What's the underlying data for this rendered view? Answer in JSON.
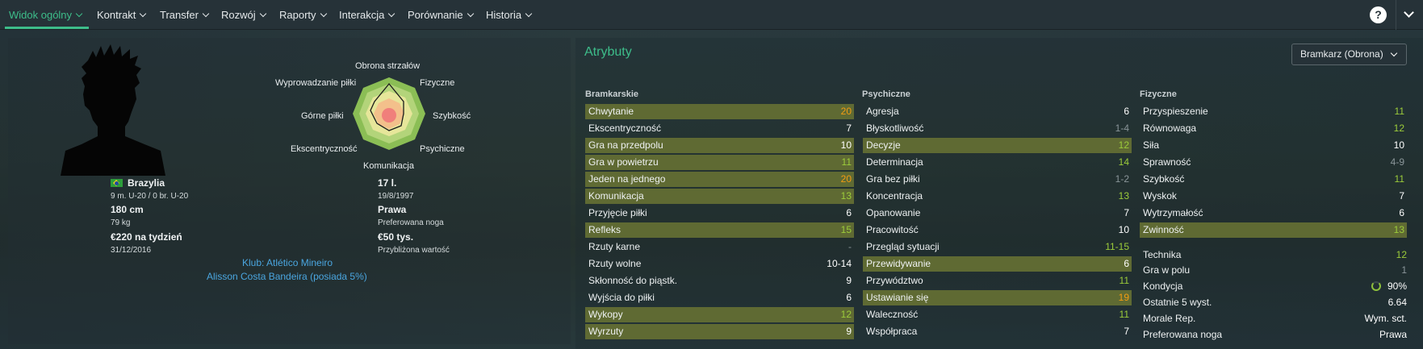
{
  "tabs": [
    {
      "label": "Widok ogólny",
      "active": true
    },
    {
      "label": "Kontrakt"
    },
    {
      "label": "Transfer"
    },
    {
      "label": "Rozwój"
    },
    {
      "label": "Raporty"
    },
    {
      "label": "Interakcja"
    },
    {
      "label": "Porównanie"
    },
    {
      "label": "Historia"
    }
  ],
  "help_label": "?",
  "radar": {
    "labels": {
      "top": "Obrona strzałów",
      "top_left": "Wyprowadzanie piłki",
      "top_right": "Fizyczne",
      "left": "Górne piłki",
      "right": "Szybkość",
      "bottom_left": "Ekscentryczność",
      "bottom_right": "Psychiczne",
      "bottom": "Komunikacja"
    }
  },
  "bio": {
    "nationality": "Brazylia",
    "caps": "9 m. U-20 / 0 br. U-20",
    "height": "180 cm",
    "weight": "79 kg",
    "wage": "€220 na tydzień",
    "contract_end": "31/12/2016",
    "age": "17 l.",
    "dob": "19/8/1997",
    "foot": "Prawa",
    "foot_label": "Preferowana noga",
    "value": "€50 tys.",
    "value_label": "Przybliżona wartość",
    "club": "Klub: Atlético Mineiro",
    "owner": "Alisson Costa Bandeira (posiada 5%)"
  },
  "attributes_title": "Atrybuty",
  "role_select": "Bramkarz (Obrona)",
  "columns": [
    {
      "header": "Bramkarskie",
      "rows": [
        {
          "name": "Chwytanie",
          "value": "20",
          "color": "#f39c12",
          "hl": true
        },
        {
          "name": "Ekscentryczność",
          "value": "7",
          "color": "#ffffff",
          "hl": false
        },
        {
          "name": "Gra na przedpolu",
          "value": "10",
          "color": "#ffffff",
          "hl": true
        },
        {
          "name": "Gra w powietrzu",
          "value": "11",
          "color": "#9ccc3a",
          "hl": true
        },
        {
          "name": "Jeden na jednego",
          "value": "20",
          "color": "#f39c12",
          "hl": true
        },
        {
          "name": "Komunikacja",
          "value": "13",
          "color": "#9ccc3a",
          "hl": true
        },
        {
          "name": "Przyjęcie piłki",
          "value": "6",
          "color": "#ffffff",
          "hl": false
        },
        {
          "name": "Refleks",
          "value": "15",
          "color": "#9ccc3a",
          "hl": true
        },
        {
          "name": "Rzuty karne",
          "value": "-",
          "color": "#8a9599",
          "hl": false
        },
        {
          "name": "Rzuty wolne",
          "value": "10-14",
          "color": "#ffffff",
          "hl": false
        },
        {
          "name": "Skłonność do piąstk.",
          "value": "9",
          "color": "#ffffff",
          "hl": false
        },
        {
          "name": "Wyjścia do piłki",
          "value": "6",
          "color": "#ffffff",
          "hl": false
        },
        {
          "name": "Wykopy",
          "value": "12",
          "color": "#9ccc3a",
          "hl": true
        },
        {
          "name": "Wyrzuty",
          "value": "9",
          "color": "#ffffff",
          "hl": true
        }
      ]
    },
    {
      "header": "Psychiczne",
      "rows": [
        {
          "name": "Agresja",
          "value": "6",
          "color": "#ffffff",
          "hl": false
        },
        {
          "name": "Błyskotliwość",
          "value": "1-4",
          "color": "#8a9599",
          "hl": false
        },
        {
          "name": "Decyzje",
          "value": "12",
          "color": "#9ccc3a",
          "hl": true
        },
        {
          "name": "Determinacja",
          "value": "14",
          "color": "#9ccc3a",
          "hl": false
        },
        {
          "name": "Gra bez piłki",
          "value": "1-2",
          "color": "#8a9599",
          "hl": false
        },
        {
          "name": "Koncentracja",
          "value": "13",
          "color": "#9ccc3a",
          "hl": false
        },
        {
          "name": "Opanowanie",
          "value": "7",
          "color": "#ffffff",
          "hl": false
        },
        {
          "name": "Pracowitość",
          "value": "10",
          "color": "#ffffff",
          "hl": false
        },
        {
          "name": "Przegląd sytuacji",
          "value": "11-15",
          "color": "#9ccc3a",
          "hl": false
        },
        {
          "name": "Przewidywanie",
          "value": "6",
          "color": "#ffffff",
          "hl": true
        },
        {
          "name": "Przywództwo",
          "value": "11",
          "color": "#9ccc3a",
          "hl": false
        },
        {
          "name": "Ustawianie się",
          "value": "19",
          "color": "#f39c12",
          "hl": true
        },
        {
          "name": "Waleczność",
          "value": "11",
          "color": "#9ccc3a",
          "hl": false
        },
        {
          "name": "Współpraca",
          "value": "7",
          "color": "#ffffff",
          "hl": false
        }
      ]
    },
    {
      "header": "Fizyczne",
      "rows": [
        {
          "name": "Przyspieszenie",
          "value": "11",
          "color": "#9ccc3a",
          "hl": false
        },
        {
          "name": "Równowaga",
          "value": "12",
          "color": "#9ccc3a",
          "hl": false
        },
        {
          "name": "Siła",
          "value": "10",
          "color": "#ffffff",
          "hl": false
        },
        {
          "name": "Sprawność",
          "value": "4-9",
          "color": "#8a9599",
          "hl": false
        },
        {
          "name": "Szybkość",
          "value": "11",
          "color": "#9ccc3a",
          "hl": false
        },
        {
          "name": "Wyskok",
          "value": "7",
          "color": "#ffffff",
          "hl": false
        },
        {
          "name": "Wytrzymałość",
          "value": "6",
          "color": "#ffffff",
          "hl": false
        },
        {
          "name": "Zwinność",
          "value": "13",
          "color": "#9ccc3a",
          "hl": true
        }
      ]
    }
  ],
  "other": [
    {
      "name": "Technika",
      "value": "12",
      "color": "#9ccc3a"
    },
    {
      "name": "Gra w polu",
      "value": "1",
      "color": "#8a9599"
    },
    {
      "name": "Kondycja",
      "value": "90%",
      "color": "#ffffff",
      "ring": true
    },
    {
      "name": "Ostatnie 5 wyst.",
      "value": "6.64",
      "color": "#ffffff"
    },
    {
      "name": "Morale Rep.",
      "value": "Wym. sct.",
      "color": "#ffffff"
    },
    {
      "name": "Preferowana noga",
      "value": "Prawa",
      "color": "#ffffff"
    }
  ]
}
